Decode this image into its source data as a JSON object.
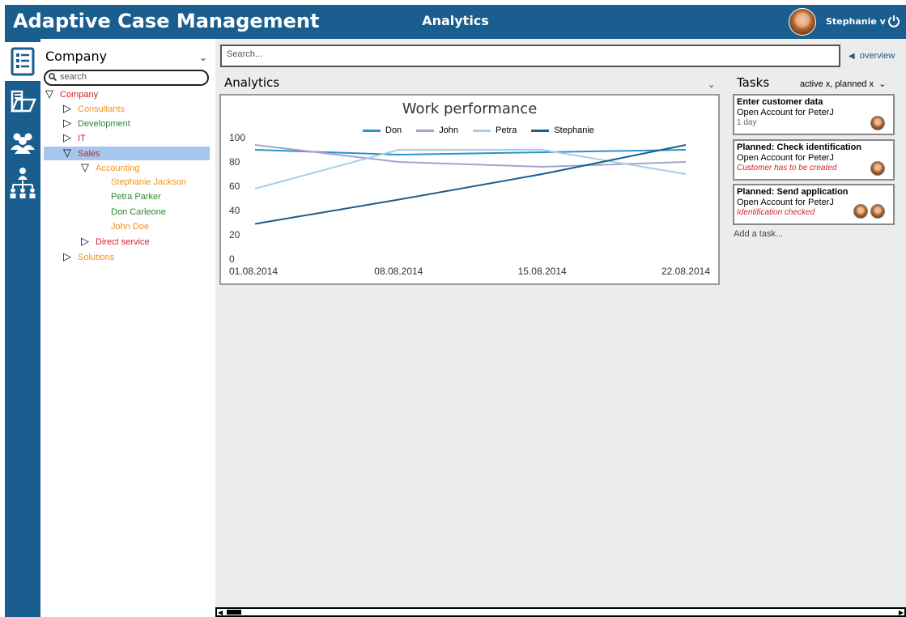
{
  "header": {
    "app_title": "Adaptive Case Management",
    "page_title": "Analytics",
    "user_name": "Stephanie v"
  },
  "rail": {
    "items": [
      {
        "icon": "checklist-icon",
        "active": true
      },
      {
        "icon": "folder-icon",
        "active": false
      },
      {
        "icon": "users-icon",
        "active": false
      },
      {
        "icon": "org-chart-icon",
        "active": false
      }
    ]
  },
  "tree": {
    "selector_label": "Company",
    "search_placeholder": "search",
    "nodes": [
      {
        "label": "Company",
        "color": "#d3212e",
        "expanded": true
      },
      {
        "label": "Consultants",
        "color": "#f3921b",
        "expanded": false
      },
      {
        "label": "Development",
        "color": "#2c8a2c",
        "expanded": false
      },
      {
        "label": "IT",
        "color": "#d3212e",
        "expanded": false
      },
      {
        "label": "Sales",
        "color": "#d3212e",
        "expanded": true,
        "selected": true
      },
      {
        "label": "Accounting",
        "color": "#f3921b",
        "expanded": true
      },
      {
        "label": "Stephanie Jackson",
        "color": "#f3921b"
      },
      {
        "label": "Petra Parker",
        "color": "#2c8a2c"
      },
      {
        "label": "Don Carleone",
        "color": "#2c8a2c"
      },
      {
        "label": "John Doe",
        "color": "#f3921b"
      },
      {
        "label": "Direct service",
        "color": "#d3212e",
        "expanded": false
      },
      {
        "label": "Solutions",
        "color": "#f3921b",
        "expanded": false
      }
    ]
  },
  "main": {
    "search_placeholder": "Search...",
    "overview_label": "overview",
    "analytics_label": "Analytics"
  },
  "tasks": {
    "title": "Tasks",
    "filter": "active x, planned x",
    "cards": [
      {
        "title": "Enter customer data",
        "subtitle": "Open Account for PeterJ",
        "note": "1 day",
        "status": ""
      },
      {
        "title": "Planned: Check identification",
        "subtitle": "Open Account for PeterJ",
        "note": "",
        "status": "Customer has to be created"
      },
      {
        "title": "Planned: Send application",
        "subtitle": "Open Account for PeterJ",
        "note": "",
        "status": "Identification checked"
      }
    ],
    "add_label": "Add a task..."
  },
  "chart_data": {
    "type": "line",
    "title": "Work performance",
    "x": [
      "01.08.2014",
      "08.08.2014",
      "15.08.2014",
      "22.08.2014"
    ],
    "ylim": [
      0,
      100
    ],
    "yticks": [
      0,
      20,
      40,
      60,
      80,
      100
    ],
    "xlabel": "",
    "ylabel": "",
    "grid": false,
    "legend": "top",
    "series": [
      {
        "name": "Don",
        "color": "#2b93c9",
        "values": [
          90,
          86,
          88,
          90
        ]
      },
      {
        "name": "John",
        "color": "#a7a3cc",
        "values": [
          94,
          80,
          76,
          80
        ]
      },
      {
        "name": "Petra",
        "color": "#a9cde6",
        "values": [
          58,
          90,
          90,
          70
        ]
      },
      {
        "name": "Stephanie",
        "color": "#1a5d8f",
        "values": [
          29,
          49,
          70,
          94
        ]
      }
    ]
  }
}
